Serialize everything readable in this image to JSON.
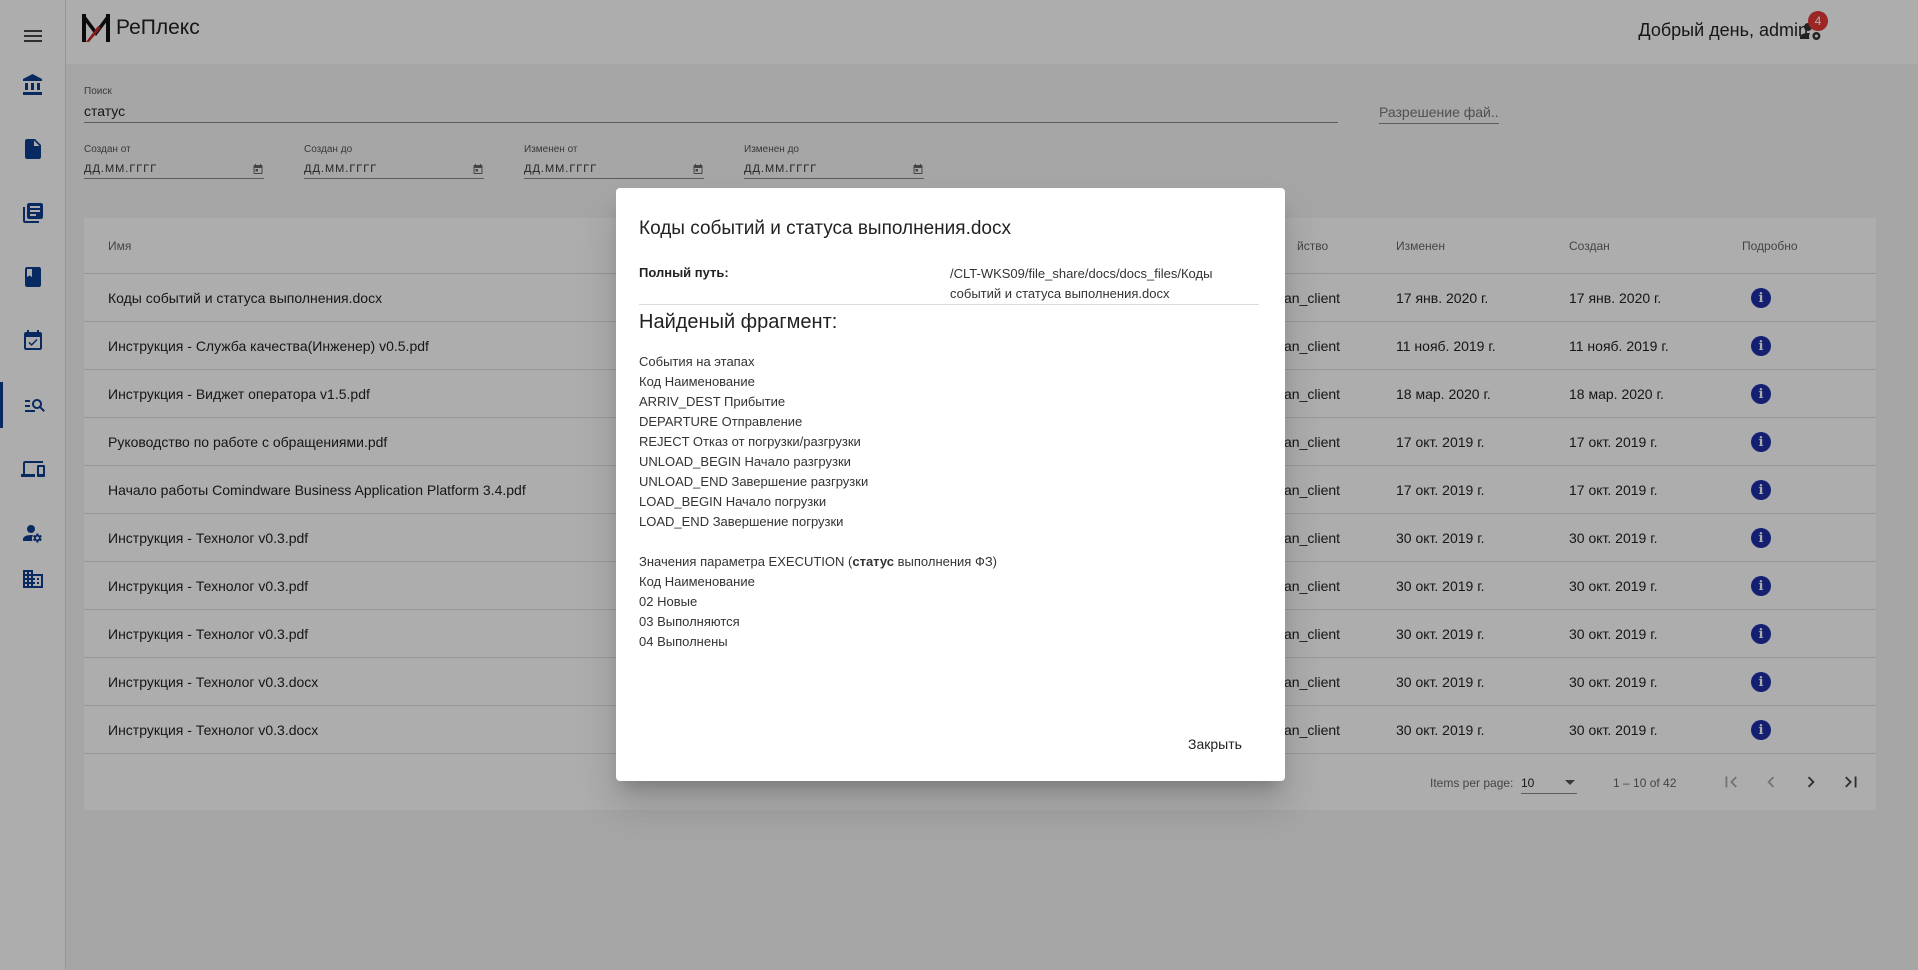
{
  "app": {
    "title": "РеПлекс"
  },
  "header": {
    "greeting": "Добрый день, admin",
    "notification_count": "4"
  },
  "search": {
    "label": "Поиск",
    "value": "статус",
    "ext_placeholder": "Разрешение фай..."
  },
  "filters": {
    "created_from": {
      "label": "Создан от",
      "placeholder": "ДД.ММ.ГГГГ"
    },
    "created_to": {
      "label": "Создан до",
      "placeholder": "ДД.ММ.ГГГГ"
    },
    "modified_from": {
      "label": "Изменен от",
      "placeholder": "ДД.ММ.ГГГГ"
    },
    "modified_to": {
      "label": "Изменен до",
      "placeholder": "ДД.ММ.ГГГГ"
    }
  },
  "table": {
    "headers": {
      "name": "Имя",
      "owner": "йство",
      "modified": "Изменен",
      "created": "Создан",
      "details": "Подробно"
    },
    "rows": [
      {
        "name": "Коды событий и статуса выполнения.docx",
        "owner": "an_client",
        "modified": "17 янв. 2020 г.",
        "created": "17 янв. 2020 г."
      },
      {
        "name": "Инструкция - Служба качества(Инженер) v0.5.pdf",
        "owner": "an_client",
        "modified": "11 нояб. 2019 г.",
        "created": "11 нояб. 2019 г."
      },
      {
        "name": "Инструкция - Виджет оператора v1.5.pdf",
        "owner": "an_client",
        "modified": "18 мар. 2020 г.",
        "created": "18 мар. 2020 г."
      },
      {
        "name": "Руководство по работе с обращениями.pdf",
        "owner": "an_client",
        "modified": "17 окт. 2019 г.",
        "created": "17 окт. 2019 г."
      },
      {
        "name": "Начало работы Comindware Business Application Platform 3.4.pdf",
        "owner": "an_client",
        "modified": "17 окт. 2019 г.",
        "created": "17 окт. 2019 г."
      },
      {
        "name": "Инструкция - Технолог v0.3.pdf",
        "owner": "an_client",
        "modified": "30 окт. 2019 г.",
        "created": "30 окт. 2019 г."
      },
      {
        "name": "Инструкция - Технолог v0.3.pdf",
        "owner": "an_client",
        "modified": "30 окт. 2019 г.",
        "created": "30 окт. 2019 г."
      },
      {
        "name": "Инструкция - Технолог v0.3.pdf",
        "owner": "an_client",
        "modified": "30 окт. 2019 г.",
        "created": "30 окт. 2019 г."
      },
      {
        "name": "Инструкция - Технолог v0.3.docx",
        "owner": "an_client",
        "modified": "30 окт. 2019 г.",
        "created": "30 окт. 2019 г."
      },
      {
        "name": "Инструкция - Технолог v0.3.docx",
        "owner": "an_client",
        "modified": "30 окт. 2019 г.",
        "created": "30 окт. 2019 г."
      }
    ]
  },
  "paginator": {
    "items_per_page_label": "Items per page:",
    "page_size": "10",
    "range": "1 – 10 of 42"
  },
  "dialog": {
    "title": "Коды событий и статуса выполнения.docx",
    "path_label": "Полный путь:",
    "path_value": "/CLT-WKS09/file_share/docs/docs_files/Коды событий и статуса выполнения.docx",
    "fragment_title": "Найденый фрагмент:",
    "fragment_lines": [
      "События на этапах",
      "Код Наименование",
      "ARRIV_DEST Прибытие",
      "DEPARTURE Отправление",
      "REJECT Отказ от погрузки/разгрузки",
      "UNLOAD_BEGIN Начало разгрузки",
      "UNLOAD_END Завершение разгрузки",
      "LOAD_BEGIN Начало погрузки",
      "LOAD_END Завершение погрузки"
    ],
    "param_line": {
      "before": "Значения параметра EXECUTION (",
      "highlight": "статус",
      "after": " выполнения ФЗ)"
    },
    "fragment_lines_2": [
      "Код Наименование",
      "02 Новые",
      "03 Выполняются",
      "04 Выполнены"
    ],
    "close_label": "Закрыть"
  },
  "colors": {
    "accent": "#0d3f8f",
    "info": "#1e2ea8",
    "badge": "#e53935"
  }
}
